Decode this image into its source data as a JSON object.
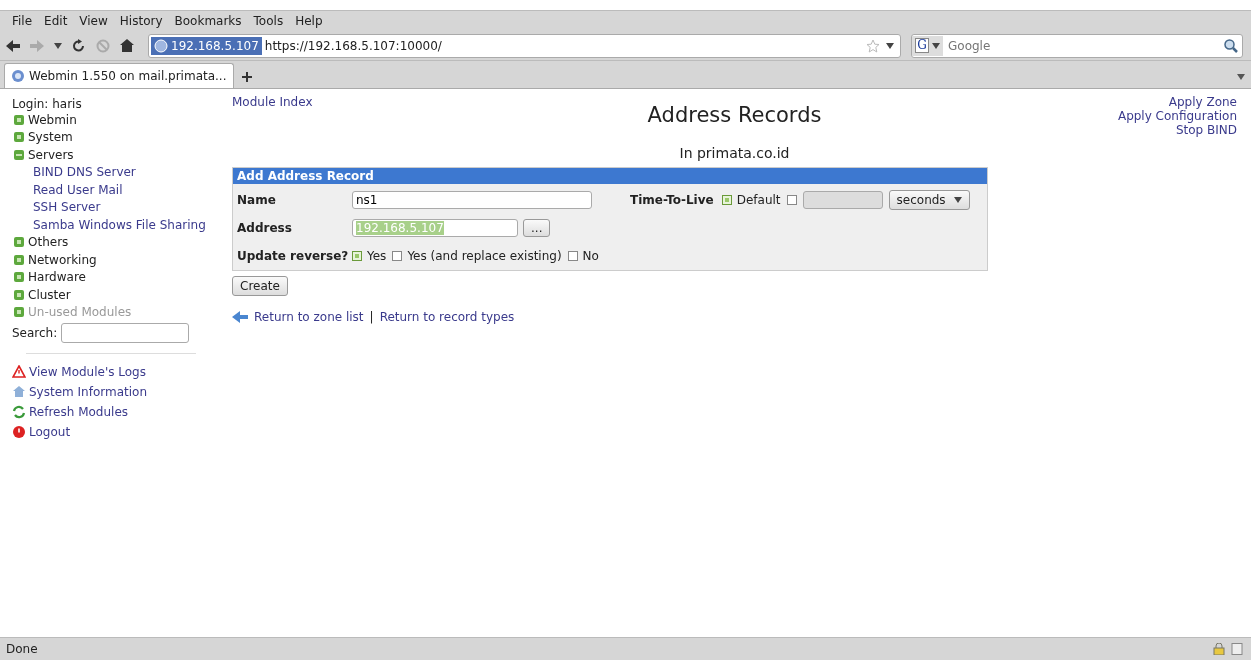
{
  "menu": [
    "File",
    "Edit",
    "View",
    "History",
    "Bookmarks",
    "Tools",
    "Help"
  ],
  "url_bar": {
    "site": "192.168.5.107",
    "url": "https://192.168.5.107:10000/"
  },
  "search": {
    "engine": "G",
    "placeholder": "Google"
  },
  "tabs": [
    {
      "label": "Webmin 1.550 on mail.primata...",
      "selected": true
    }
  ],
  "sidebar": {
    "login": "Login: haris",
    "items": [
      {
        "label": "Webmin",
        "expanded": false,
        "disabled": false
      },
      {
        "label": "System",
        "expanded": false,
        "disabled": false
      },
      {
        "label": "Servers",
        "expanded": true,
        "disabled": false,
        "children": [
          "BIND DNS Server",
          "Read User Mail",
          "SSH Server",
          "Samba Windows File Sharing"
        ]
      },
      {
        "label": "Others",
        "expanded": false,
        "disabled": false
      },
      {
        "label": "Networking",
        "expanded": false,
        "disabled": false
      },
      {
        "label": "Hardware",
        "expanded": false,
        "disabled": false
      },
      {
        "label": "Cluster",
        "expanded": false,
        "disabled": false
      },
      {
        "label": "Un-used Modules",
        "expanded": false,
        "disabled": true
      }
    ],
    "search_label": "Search:",
    "links": [
      {
        "kind": "warning",
        "label": "View Module's Logs"
      },
      {
        "kind": "house",
        "label": "System Information"
      },
      {
        "kind": "refresh",
        "label": "Refresh Modules"
      },
      {
        "kind": "power",
        "label": "Logout"
      }
    ]
  },
  "main": {
    "module_index": "Module Index",
    "title": "Address Records",
    "subtitle": "In primata.co.id",
    "actions": [
      "Apply Zone",
      "Apply Configuration",
      "Stop BIND"
    ],
    "form": {
      "header": "Add Address Record",
      "name_label": "Name",
      "name_value": "ns1",
      "ttl_label": "Time-To-Live",
      "ttl_default_label": "Default",
      "ttl_default": true,
      "ttl_unit": "seconds",
      "address_label": "Address",
      "address_value": "192.168.5.107",
      "address_button": "...",
      "reverse_label": "Update reverse?",
      "reverse_options": [
        {
          "label": "Yes",
          "selected": true
        },
        {
          "label": "Yes (and replace existing)",
          "selected": false
        },
        {
          "label": "No",
          "selected": false
        }
      ]
    },
    "create_button": "Create",
    "links": [
      "Return to zone list",
      "Return to record types"
    ],
    "separator": "|"
  },
  "status_bar": "Done"
}
